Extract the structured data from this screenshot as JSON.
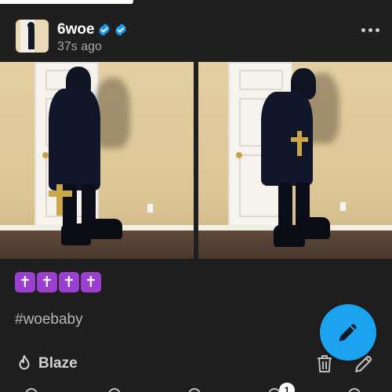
{
  "post": {
    "username": "6woe",
    "timestamp": "37s ago",
    "emoji_text": [
      "✝",
      "✝",
      "✝",
      "✝"
    ],
    "hashtag": "#woebaby"
  },
  "actions": {
    "blaze_label": "Blaze"
  },
  "bottom_nav": {
    "notification_count": "1"
  },
  "colors": {
    "background": "#1f1f1f",
    "accent_blue": "#1ca3ef",
    "verified_blue": "#1d9bf0",
    "emoji_purple": "#9b3fd1"
  },
  "icons": [
    "verified-badge-icon",
    "more-options-icon",
    "flame-icon",
    "trash-icon",
    "pencil-icon",
    "compose-pencil-icon"
  ]
}
